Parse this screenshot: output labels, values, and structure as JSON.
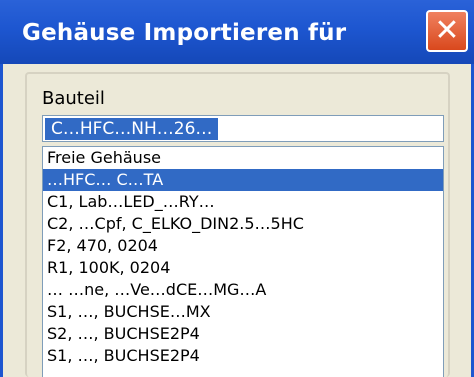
{
  "window": {
    "title": "Gehäuse Importieren für",
    "close_symbol": "✕"
  },
  "group": {
    "label": "Bauteil"
  },
  "combo": {
    "value": "C…HFC…NH…26…"
  },
  "list": {
    "items": [
      {
        "label": "Freie Gehäuse",
        "selected": false
      },
      {
        "label": "…HFC…  C…TA",
        "selected": true
      },
      {
        "label": "C1, Lab…LED_…RY…",
        "selected": false
      },
      {
        "label": "C2, …Cpf, C_ELKO_DIN2.5…5HC",
        "selected": false
      },
      {
        "label": "F2, 470, 0204",
        "selected": false
      },
      {
        "label": "R1, 100K, 0204",
        "selected": false
      },
      {
        "label": "…  …ne, …Ve…dCE…MG…A",
        "selected": false
      },
      {
        "label": "S1, …, BUCHSE…MX",
        "selected": false
      },
      {
        "label": "S2, …, BUCHSE2P4",
        "selected": false
      },
      {
        "label": "S1, …, BUCHSE2P4",
        "selected": false
      }
    ]
  },
  "colors": {
    "titlebar": "#1d56d0",
    "selection": "#316ac5",
    "dialog_face": "#ece9d8",
    "close_button": "#d9481d"
  }
}
